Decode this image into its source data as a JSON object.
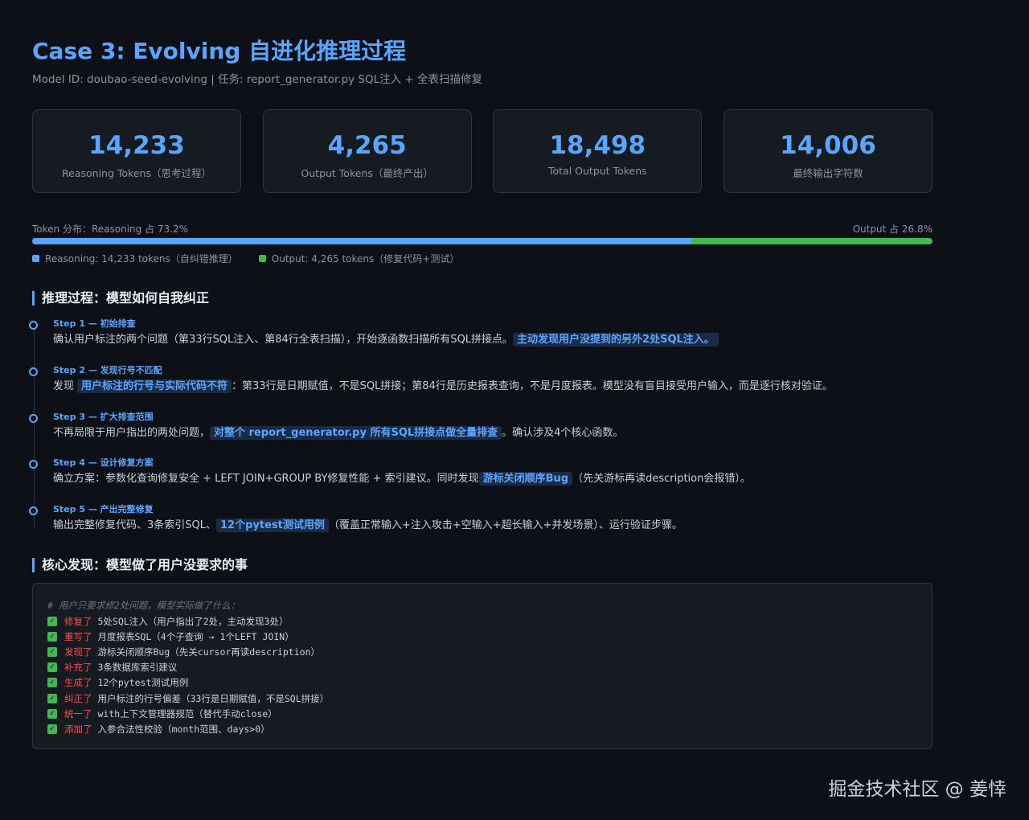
{
  "header": {
    "title": "Case 3: Evolving 自进化推理过程",
    "subtitle": "Model ID: doubao-seed-evolving | 任务: report_generator.py SQL注入 + 全表扫描修复"
  },
  "stats": [
    {
      "value": "14,233",
      "label": "Reasoning Tokens（思考过程）"
    },
    {
      "value": "4,265",
      "label": "Output Tokens（最终产出）"
    },
    {
      "value": "18,498",
      "label": "Total Output Tokens"
    },
    {
      "value": "14,006",
      "label": "最终输出字符数"
    }
  ],
  "token_distribution": {
    "left_label": "Token 分布：Reasoning 占 73.2%",
    "right_label": "Output 占 26.8%",
    "reasoning_fraction": 0.732,
    "output_fraction": 0.268,
    "reasoning_color": "#58a6ff",
    "output_color": "#3fb950",
    "legend": [
      {
        "label": "Reasoning: 14,233 tokens（自纠错推理）",
        "color": "#58a6ff"
      },
      {
        "label": "Output: 4,265 tokens（修复代码+测试）",
        "color": "#3fb950"
      }
    ]
  },
  "reasoning": {
    "title": "推理过程：模型如何自我纠正",
    "steps": [
      {
        "label": "Step 1 — 初始排查",
        "pre": "确认用户标注的两个问题（第33行SQL注入、第84行全表扫描），开始逐函数扫描所有SQL拼接点。",
        "highlight": "主动发现用户没提到的另外2处SQL注入。",
        "post": ""
      },
      {
        "label": "Step 2 — 发现行号不匹配",
        "pre": "发现",
        "highlight": "用户标注的行号与实际代码不符",
        "post": "：第33行是日期赋值，不是SQL拼接；第84行是历史报表查询，不是月度报表。模型没有盲目接受用户输入，而是逐行核对验证。"
      },
      {
        "label": "Step 3 — 扩大排查范围",
        "pre": "不再局限于用户指出的两处问题，",
        "highlight": "对整个 report_generator.py 所有SQL拼接点做全量排查",
        "post": "。确认涉及4个核心函数。"
      },
      {
        "label": "Step 4 — 设计修复方案",
        "pre": "确立方案：参数化查询修复安全 + LEFT JOIN+GROUP BY修复性能 + 索引建议。同时发现",
        "highlight": "游标关闭顺序Bug",
        "post": "（先关游标再读description会报错）。"
      },
      {
        "label": "Step 5 — 产出完整修复",
        "pre": "输出完整修复代码、3条索引SQL、",
        "highlight": "12个pytest测试用例",
        "post": "（覆盖正常输入+注入攻击+空输入+超长输入+并发场景）、运行验证步骤。"
      }
    ]
  },
  "findings": {
    "title": "核心发现：模型做了用户没要求的事",
    "comment": "# 用户只要求修2处问题，模型实际做了什么：",
    "items": [
      {
        "verb": "修复了",
        "text": "5处SQL注入（用户指出了2处，主动发现3处）"
      },
      {
        "verb": "重写了",
        "text": "月度报表SQL（4个子查询 → 1个LEFT JOIN）"
      },
      {
        "verb": "发现了",
        "text": "游标关闭顺序Bug（先关cursor再读description）"
      },
      {
        "verb": "补充了",
        "text": "3条数据库索引建议"
      },
      {
        "verb": "生成了",
        "text": "12个pytest测试用例"
      },
      {
        "verb": "纠正了",
        "text": "用户标注的行号偏差（33行是日期赋值，不是SQL拼接）"
      },
      {
        "verb": "统一了",
        "text": "with上下文管理器规范（替代手动close）"
      },
      {
        "verb": "添加了",
        "text": "入参合法性校验（month范围、days>0）"
      }
    ]
  },
  "watermark": "掘金技术社区 @ 姜悻"
}
